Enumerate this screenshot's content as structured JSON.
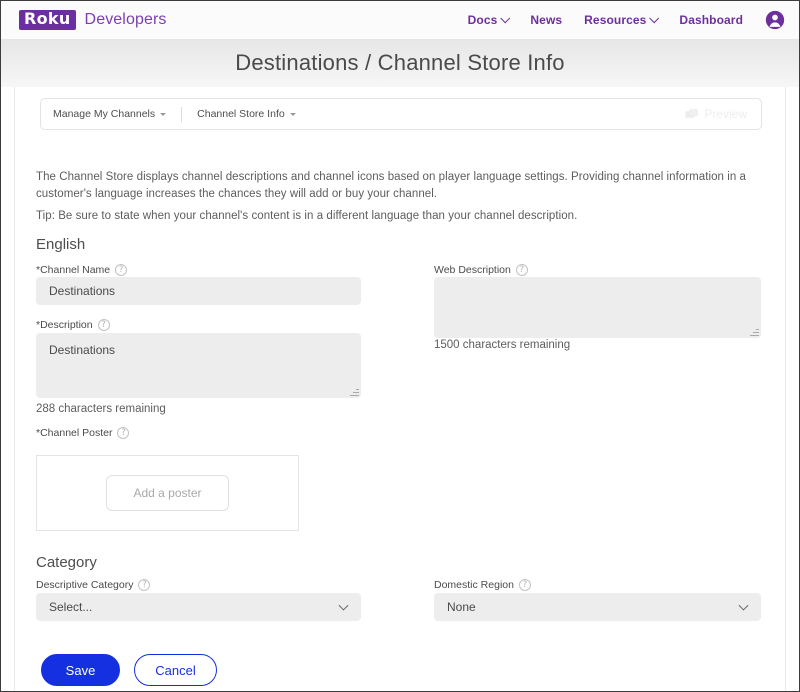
{
  "header": {
    "logo_text": "Roku",
    "logo_sub": "Developers",
    "nav": [
      {
        "label": "Docs",
        "has_caret": true
      },
      {
        "label": "News",
        "has_caret": false
      },
      {
        "label": "Resources",
        "has_caret": true
      },
      {
        "label": "Dashboard",
        "has_caret": false
      }
    ],
    "account_icon": "account-circle-icon",
    "brand_purple": "#6d2f9c"
  },
  "page_title": "Destinations / Channel Store Info",
  "toolbar": {
    "breadcrumb_1": "Manage My Channels",
    "breadcrumb_2": "Channel Store Info",
    "preview_label": "Preview",
    "preview_icon": "tv-screen-icon",
    "preview_disabled": true
  },
  "intro": {
    "paragraph_1": "The Channel Store displays channel descriptions and channel icons based on player language settings. Providing channel information in a customer's language increases the chances they will add or buy your channel.",
    "paragraph_2": "Tip: Be sure to state when your channel's content is in a different language than your channel description."
  },
  "english_section": {
    "heading": "English",
    "channel_name": {
      "label": "*Channel Name",
      "help_icon": "question-mark-icon",
      "value": "Destinations",
      "placeholder": ""
    },
    "description": {
      "label": "*Description",
      "help_icon": "question-mark-icon",
      "value": "Destinations",
      "placeholder": "",
      "counter": "288 characters remaining"
    },
    "web_description": {
      "label": "Web Description",
      "help_icon": "question-mark-icon",
      "value": "",
      "placeholder": "",
      "counter": "1500 characters remaining"
    },
    "channel_poster": {
      "label": "*Channel Poster",
      "help_icon": "question-mark-icon",
      "button_label": "Add a poster"
    }
  },
  "category_section": {
    "heading": "Category",
    "descriptive_category": {
      "label": "Descriptive Category",
      "help_icon": "question-mark-icon",
      "selected": "Select...",
      "options": [
        "Select..."
      ]
    },
    "domestic_region": {
      "label": "Domestic Region",
      "help_icon": "question-mark-icon",
      "selected": "None",
      "options": [
        "None"
      ]
    }
  },
  "footer": {
    "save_label": "Save",
    "cancel_label": "Cancel",
    "accent_blue": "#1530e0"
  }
}
